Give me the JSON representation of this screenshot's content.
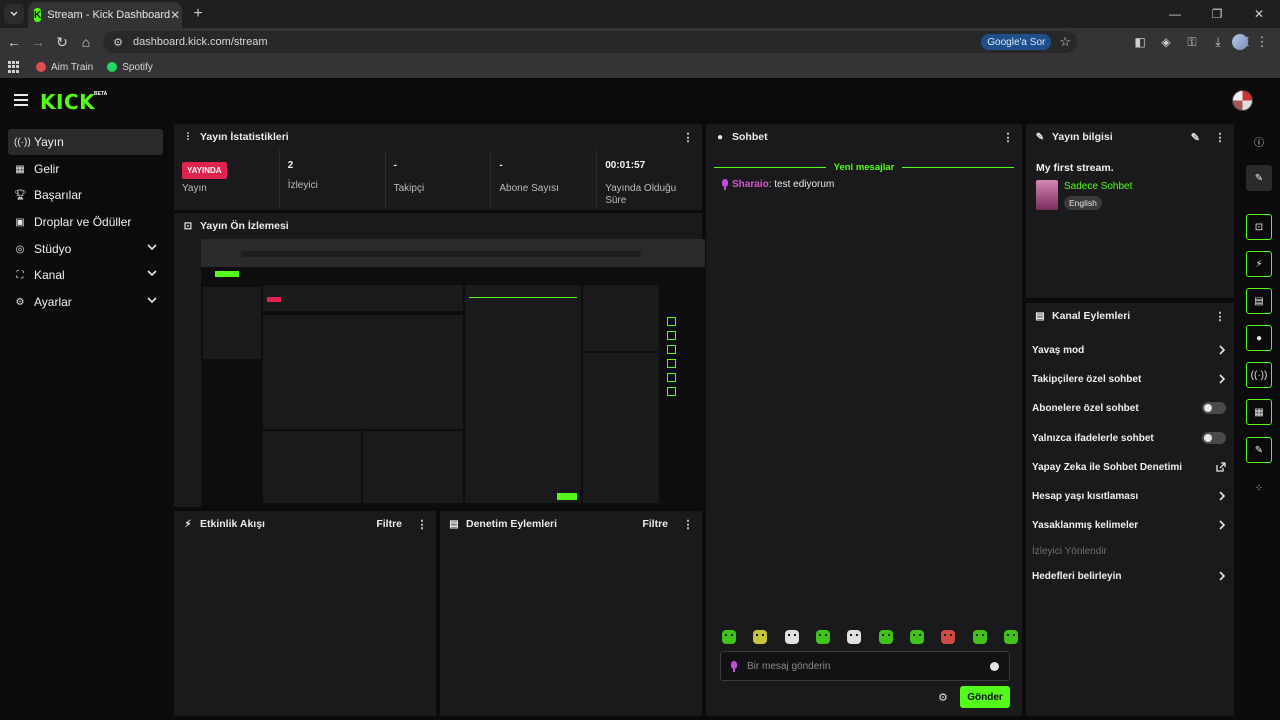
{
  "browser": {
    "tab_title": "Stream - Kick Dashboard",
    "tab_favicon": "K",
    "url": "dashboard.kick.com/stream",
    "google_chip": "Google'a Sor",
    "bookmarks": [
      {
        "label": "Aim Train",
        "color": "#e04f4f"
      },
      {
        "label": "Spotify",
        "color": "#1ed760"
      }
    ]
  },
  "header": {
    "logo": "KICK",
    "logo_badge": "BETA"
  },
  "sidebar": {
    "items": [
      {
        "label": "Yayın",
        "icon": "broadcast-icon",
        "active": true
      },
      {
        "label": "Gelir",
        "icon": "revenue-icon"
      },
      {
        "label": "Başarılar",
        "icon": "trophy-icon"
      },
      {
        "label": "Droplar ve Ödüller",
        "icon": "gift-icon"
      },
      {
        "label": "Stüdyo",
        "icon": "studio-icon",
        "expandable": true
      },
      {
        "label": "Kanal",
        "icon": "channel-icon",
        "expandable": true
      },
      {
        "label": "Ayarlar",
        "icon": "gear-icon",
        "expandable": true
      }
    ]
  },
  "stats": {
    "title": "Yayın İstatistikleri",
    "live_badge": "YAYINDA",
    "live_label": "Yayın",
    "viewers_value": "2",
    "viewers_label": "İzleyici",
    "followers_value": "-",
    "followers_label": "Takipçi",
    "subs_value": "-",
    "subs_label": "Abone Sayısı",
    "duration_value": "00:01:57",
    "duration_label": "Yayında Olduğu Süre"
  },
  "preview": {
    "title": "Yayın Ön İzlemesi"
  },
  "activity": {
    "title": "Etkinlik Akışı",
    "filter": "Filtre"
  },
  "moderation": {
    "title": "Denetim Eylemleri",
    "filter": "Filtre"
  },
  "chat": {
    "title": "Sohbet",
    "new_messages": "Yeni mesajlar",
    "messages": [
      {
        "user": "Sharaio",
        "separator": ": ",
        "text": "test ediyorum"
      }
    ],
    "input_placeholder": "Bir mesaj gönderin",
    "send_label": "Gönder"
  },
  "stream_info": {
    "title": "Yayın bilgisi",
    "stream_title": "My first stream.",
    "category": "Sadece Sohbet",
    "language": "English"
  },
  "channel_actions": {
    "title": "Kanal Eylemleri",
    "items": [
      {
        "label": "Yavaş mod",
        "control": "chevron"
      },
      {
        "label": "Takipçilere özel sohbet",
        "control": "chevron"
      },
      {
        "label": "Abonelere özel sohbet",
        "control": "toggle",
        "state": "off"
      },
      {
        "label": "Yalnızca ifadelerle sohbet",
        "control": "toggle",
        "state": "off"
      },
      {
        "label": "Yapay Zeka ile Sohbet Denetimi",
        "control": "external"
      },
      {
        "label": "Hesap yaşı kısıtlaması",
        "control": "chevron"
      },
      {
        "label": "Yasaklanmış kelimeler",
        "control": "chevron"
      },
      {
        "label": "İzleyici Yönlendir",
        "control": "none",
        "disabled": true
      },
      {
        "label": "Hedefleri belirleyin",
        "control": "chevron"
      }
    ]
  },
  "accent_color": "#53fc18",
  "live_color": "#e0234e"
}
